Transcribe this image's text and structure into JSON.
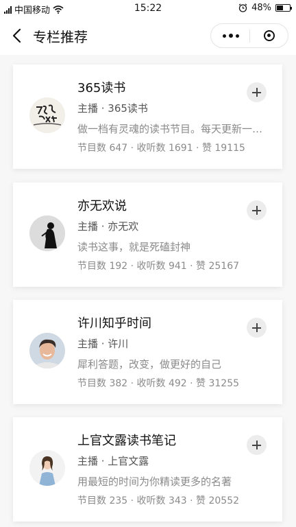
{
  "status_bar": {
    "carrier": "中国移动",
    "time": "15:22",
    "battery": "48%",
    "battery_level": 0.48,
    "signal_icon": "signal-icon",
    "wifi_icon": "wifi-icon",
    "alarm_icon": "alarm-icon"
  },
  "nav": {
    "title": "专栏推荐",
    "back_icon": "chevron-left-icon",
    "more_icon": "more-dots-icon",
    "close_icon": "miniprogram-close-icon"
  },
  "columns": [
    {
      "title": "365读书",
      "host": "主播 · 365读书",
      "desc": "做一档有灵魂的读书节目。每天更新一期，分享好书。",
      "stats": "节目数 647 · 收听数 1691 · 赞 19115",
      "avatar": "calligraphy-logo-avatar"
    },
    {
      "title": "亦无欢说",
      "host": "主播 · 亦无欢",
      "desc": "读书这事，就是死磕封神",
      "stats": "节目数 192 · 收听数 941 · 赞 25167",
      "avatar": "silhouette-avatar"
    },
    {
      "title": "许川知乎时间",
      "host": "主播 · 许川",
      "desc": "犀利答题，改变，做更好的自己",
      "stats": "节目数 382 · 收听数 492 · 赞 31255",
      "avatar": "man-portrait-avatar"
    },
    {
      "title": "上官文露读书笔记",
      "host": "主播 · 上官文露",
      "desc": "用最短的时间为你精读更多的名著",
      "stats": "节目数 235 · 收听数 343 · 赞 20552",
      "avatar": "woman-portrait-avatar"
    }
  ],
  "colors": {
    "background": "#f7f7f7",
    "card": "#ffffff",
    "secondary_text": "#8a8a8a",
    "add_button": "#ececec"
  }
}
